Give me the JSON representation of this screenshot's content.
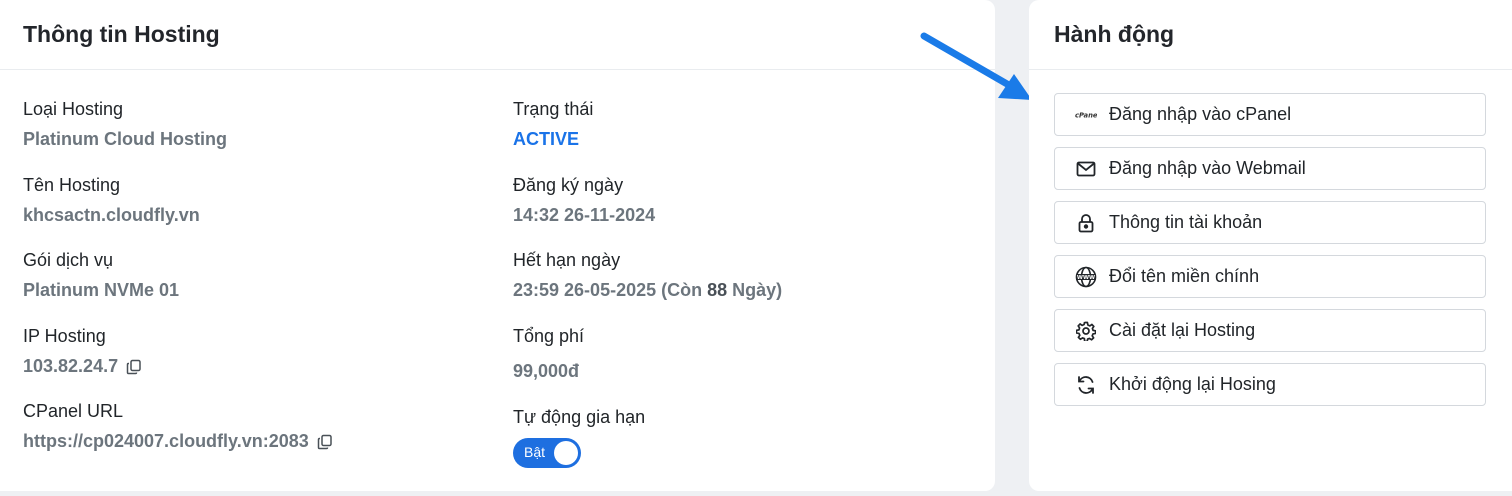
{
  "info_card": {
    "title": "Thông tin Hosting",
    "left_fields": [
      {
        "label": "Loại Hosting",
        "value": "Platinum Cloud Hosting"
      },
      {
        "label": "Tên Hosting",
        "value": "khcsactn.cloudfly.vn"
      },
      {
        "label": "Gói dịch vụ",
        "value": "Platinum NVMe 01"
      },
      {
        "label": "IP Hosting",
        "value": "103.82.24.7"
      },
      {
        "label": "CPanel URL",
        "value": "https://cp024007.cloudfly.vn:2083"
      }
    ],
    "status": {
      "label": "Trạng thái",
      "value": "ACTIVE"
    },
    "registered": {
      "label": "Đăng ký ngày",
      "value": "14:32 26-11-2024"
    },
    "expiry": {
      "label": "Hết hạn ngày",
      "value_prefix": "23:59 26-05-2025 (Còn ",
      "days": "88",
      "value_suffix": " Ngày)"
    },
    "total_fee": {
      "label": "Tổng phí",
      "value": "99,000đ"
    },
    "auto_renew": {
      "label": "Tự động gia hạn",
      "toggle_text": "Bật",
      "enabled": true
    }
  },
  "actions_card": {
    "title": "Hành động",
    "buttons": [
      {
        "label": "Đăng nhập vào cPanel",
        "icon": "cpanel-logo-icon",
        "logo_text": "cPanel"
      },
      {
        "label": "Đăng nhập vào Webmail",
        "icon": "envelope-icon"
      },
      {
        "label": "Thông tin tài khoản",
        "icon": "lock-icon"
      },
      {
        "label": "Đổi tên miền chính",
        "icon": "www-globe-icon"
      },
      {
        "label": "Cài đặt lại Hosting",
        "icon": "gear-icon"
      },
      {
        "label": "Khởi động lại Hosing",
        "icon": "refresh-icon"
      }
    ]
  },
  "colors": {
    "accent": "#1e6fe0",
    "active_status": "#1a73e8",
    "arrow": "#1a7be8"
  }
}
